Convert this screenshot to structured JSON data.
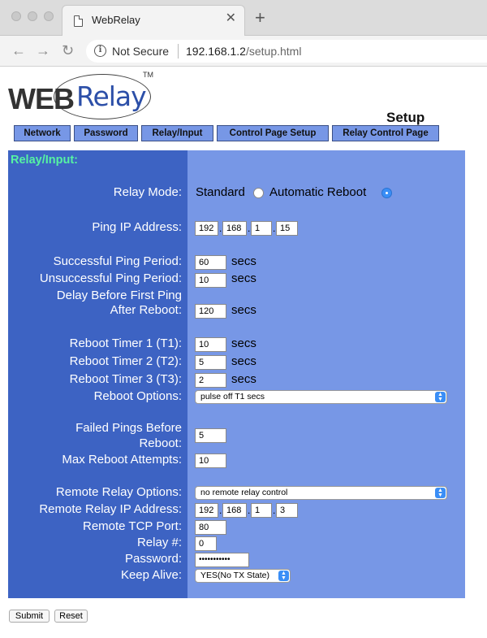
{
  "browser": {
    "tab_title": "WebRelay",
    "tab_close": "✕",
    "new_tab": "+",
    "back": "←",
    "forward": "→",
    "reload": "↻",
    "info": "i",
    "security_label": "Not Secure",
    "url_host": "192.168.1.2",
    "url_path": "/setup.html"
  },
  "logo": {
    "web": "WEB",
    "relay": "Relay",
    "tm": "TM"
  },
  "heading": "Setup",
  "nav_tabs": [
    {
      "label": "Network"
    },
    {
      "label": "Password"
    },
    {
      "label": "Relay/Input"
    },
    {
      "label": "Control Page Setup"
    },
    {
      "label": "Relay Control Page"
    }
  ],
  "section_title": "Relay/Input:",
  "form": {
    "relay_mode": {
      "label": "Relay Mode:",
      "option_standard": "Standard",
      "option_auto_reboot": "Automatic Reboot",
      "selected": "Automatic Reboot"
    },
    "ping_ip": {
      "label": "Ping IP Address:",
      "octets": [
        "192",
        "168",
        "1",
        "15"
      ],
      "sep": "."
    },
    "successful_ping_period": {
      "label": "Successful Ping Period:",
      "value": "60",
      "unit": "secs"
    },
    "unsuccessful_ping_period": {
      "label": "Unsuccessful Ping Period:",
      "value": "10",
      "unit": "secs"
    },
    "delay_first_ping": {
      "label_line1": "Delay Before First Ping",
      "label_line2": "After Reboot:",
      "value": "120",
      "unit": "secs"
    },
    "reboot_timer_1": {
      "label": "Reboot Timer 1 (T1):",
      "value": "10",
      "unit": "secs"
    },
    "reboot_timer_2": {
      "label": "Reboot Timer 2 (T2):",
      "value": "5",
      "unit": "secs"
    },
    "reboot_timer_3": {
      "label": "Reboot Timer 3 (T3):",
      "value": "2",
      "unit": "secs"
    },
    "reboot_options": {
      "label": "Reboot Options:",
      "selected": "pulse off T1 secs"
    },
    "failed_pings": {
      "label_line1": "Failed Pings Before",
      "label_line2": "Reboot:",
      "value": "5"
    },
    "max_reboot_attempts": {
      "label": "Max Reboot Attempts:",
      "value": "10"
    },
    "remote_relay_options": {
      "label": "Remote Relay Options:",
      "selected": "no remote relay control"
    },
    "remote_relay_ip": {
      "label": "Remote Relay IP Address:",
      "octets": [
        "192",
        "168",
        "1",
        "3"
      ],
      "sep": "."
    },
    "remote_tcp_port": {
      "label": "Remote TCP Port:",
      "value": "80"
    },
    "relay_number": {
      "label": "Relay #:",
      "value": "0"
    },
    "password": {
      "label": "Password:",
      "value": "•••••••••••"
    },
    "keep_alive": {
      "label": "Keep Alive:",
      "selected": "YES(No TX State)"
    }
  },
  "buttons": {
    "submit": "Submit",
    "reset": "Reset"
  },
  "colors": {
    "panel_light": "#7797e6",
    "panel_dark": "#3d63c3",
    "section_title": "#56f3a3",
    "select_arrow": "#3a8ef6"
  }
}
